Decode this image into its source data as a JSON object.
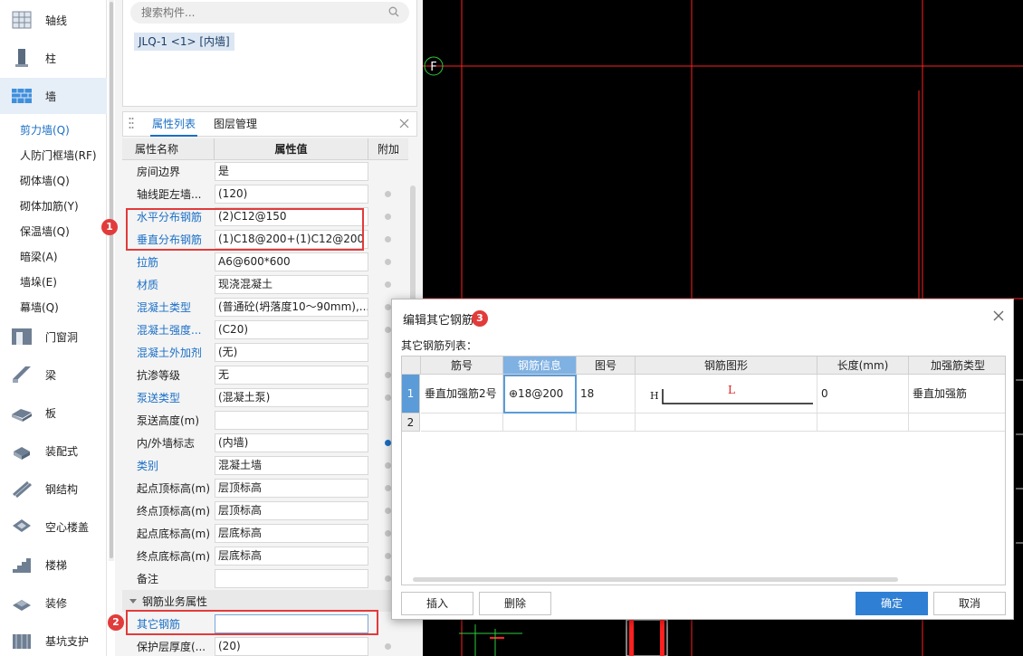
{
  "sidebar": {
    "categories": [
      {
        "label": "轴线",
        "icon": "grid-axis-icon"
      },
      {
        "label": "柱",
        "icon": "column-icon"
      },
      {
        "label": "墙",
        "icon": "wall-icon"
      },
      {
        "label": "门窗洞",
        "icon": "door-window-icon"
      },
      {
        "label": "梁",
        "icon": "beam-icon"
      },
      {
        "label": "板",
        "icon": "slab-icon"
      },
      {
        "label": "装配式",
        "icon": "prefab-icon"
      },
      {
        "label": "钢结构",
        "icon": "steel-structure-icon"
      },
      {
        "label": "空心楼盖",
        "icon": "hollow-floor-icon"
      },
      {
        "label": "楼梯",
        "icon": "stairs-icon"
      },
      {
        "label": "装修",
        "icon": "decoration-icon"
      },
      {
        "label": "基坑支护",
        "icon": "foundation-pit-icon"
      }
    ],
    "wall_items": [
      "剪力墙(Q)",
      "人防门框墙(RF)",
      "砌体墙(Q)",
      "砌体加筋(Y)",
      "保温墙(Q)",
      "暗梁(A)",
      "墙垛(E)",
      "幕墙(Q)"
    ]
  },
  "search": {
    "placeholder": "搜索构件..."
  },
  "component_chip": "JLQ-1 <1> [内墙]",
  "prop_tabs": {
    "active": "属性列表",
    "second": "图层管理"
  },
  "prop_header": {
    "name": "属性名称",
    "value": "属性值",
    "extra": "附加"
  },
  "props": [
    {
      "name": "房间边界",
      "value": "是",
      "link": false,
      "dot": ""
    },
    {
      "name": "轴线距左墙...",
      "value": "(120)",
      "link": false,
      "dot": "grey"
    },
    {
      "name": "水平分布钢筋",
      "value": "(2)C12@150",
      "link": true,
      "dot": "grey"
    },
    {
      "name": "垂直分布钢筋",
      "value": "(1)C18@200+(1)C12@200",
      "link": true,
      "dot": "grey"
    },
    {
      "name": "拉筋",
      "value": "A6@600*600",
      "link": true,
      "dot": "grey"
    },
    {
      "name": "材质",
      "value": "现浇混凝土",
      "link": true,
      "dot": "grey"
    },
    {
      "name": "混凝土类型",
      "value": "(普通砼(坍落度10～90mm),...",
      "link": true,
      "dot": "grey"
    },
    {
      "name": "混凝土强度...",
      "value": "(C20)",
      "link": true,
      "dot": "grey"
    },
    {
      "name": "混凝土外加剂",
      "value": "(无)",
      "link": true,
      "dot": ""
    },
    {
      "name": "抗渗等级",
      "value": "无",
      "link": false,
      "dot": "grey"
    },
    {
      "name": "泵送类型",
      "value": "(混凝土泵)",
      "link": true,
      "dot": "grey"
    },
    {
      "name": "泵送高度(m)",
      "value": "",
      "link": false,
      "dot": ""
    },
    {
      "name": "内/外墙标志",
      "value": "(内墙)",
      "link": false,
      "dot": "blue"
    },
    {
      "name": "类别",
      "value": "混凝土墙",
      "link": true,
      "dot": "grey"
    },
    {
      "name": "起点顶标高(m)",
      "value": "层顶标高",
      "link": false,
      "dot": "grey"
    },
    {
      "name": "终点顶标高(m)",
      "value": "层顶标高",
      "link": false,
      "dot": "grey"
    },
    {
      "name": "起点底标高(m)",
      "value": "层底标高",
      "link": false,
      "dot": "grey"
    },
    {
      "name": "终点底标高(m)",
      "value": "层底标高",
      "link": false,
      "dot": "grey"
    },
    {
      "name": "备注",
      "value": "",
      "link": false,
      "dot": "grey"
    }
  ],
  "rebar_section": {
    "title": "钢筋业务属性",
    "other_rebar_label": "其它钢筋",
    "other_rebar_value": "",
    "ellipsis": "···",
    "cover_label": "保护层厚度(...",
    "cover_value": "(20)"
  },
  "annotations": [
    "1",
    "2",
    "3"
  ],
  "cad": {
    "axis_label": "F"
  },
  "dialog": {
    "title": "编辑其它钢筋",
    "subtitle": "其它钢筋列表：",
    "columns": [
      "筋号",
      "钢筋信息",
      "图号",
      "钢筋图形",
      "长度(mm)",
      "加强筋类型"
    ],
    "rows": [
      {
        "index": "1",
        "bar_no": "垂直加强筋2号",
        "info": "⊕18@200",
        "fig": "18",
        "shape_h": "H",
        "shape_l": "L",
        "length": "0",
        "type": "垂直加强筋"
      },
      {
        "index": "2",
        "bar_no": "",
        "info": "",
        "fig": "",
        "shape_h": "",
        "shape_l": "",
        "length": "",
        "type": ""
      }
    ],
    "buttons": {
      "insert": "插入",
      "delete": "删除",
      "ok": "确定",
      "cancel": "取消"
    }
  },
  "colors": {
    "accent": "#1a6fc6",
    "highlight_red": "#e23b3b",
    "cad_grid_red": "#ff2020",
    "cad_bg": "#000000"
  }
}
